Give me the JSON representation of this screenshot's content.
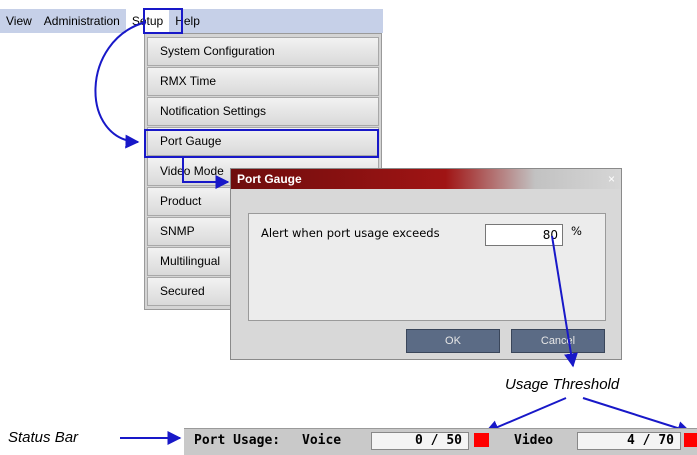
{
  "menubar": {
    "items": [
      "View",
      "Administration",
      "Setup",
      "Help"
    ]
  },
  "setup_menu": {
    "items": [
      "System Configuration",
      "RMX Time",
      "Notification Settings",
      "Port Gauge",
      "Video Mode",
      "Product",
      "SNMP",
      "Multilingual",
      "Secured"
    ]
  },
  "dialog": {
    "title": "Port Gauge",
    "close": "×",
    "label": "Alert when port usage exceeds",
    "value": "80",
    "unit": "%",
    "ok": "OK",
    "cancel": "Cancel"
  },
  "annotations": {
    "usage_threshold": "Usage Threshold",
    "status_bar": "Status Bar"
  },
  "status_bar": {
    "label": "Port Usage:",
    "voice_label": "Voice",
    "voice_value": "0 / 50",
    "video_label": "Video",
    "video_value": "4 / 70"
  },
  "colors": {
    "highlight": "#1818c8",
    "alert": "#ff0000"
  }
}
